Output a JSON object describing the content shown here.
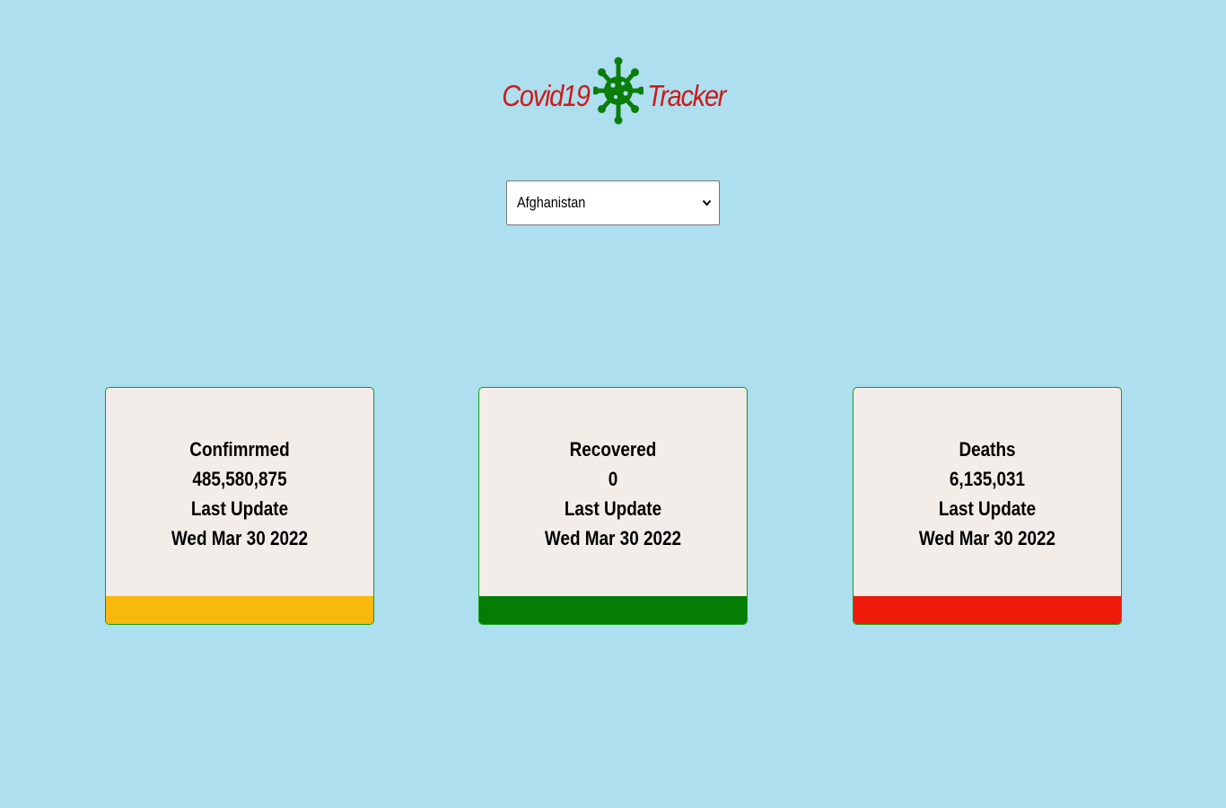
{
  "header": {
    "title_left": "Covid19",
    "title_right": "Tracker",
    "title_color": "#cc1a1a",
    "logo_icon": "virus-icon",
    "logo_color": "#0a7d0a"
  },
  "country_select": {
    "selected": "Afghanistan",
    "icon": "chevron-down-icon"
  },
  "cards": [
    {
      "label": "Confimrmed",
      "value": "485,580,875",
      "update_label": "Last Update",
      "update_date": "Wed Mar 30 2022",
      "bar_color": "#f8b80c"
    },
    {
      "label": "Recovered",
      "value": "0",
      "update_label": "Last Update",
      "update_date": "Wed Mar 30 2022",
      "bar_color": "#047d04"
    },
    {
      "label": "Deaths",
      "value": "6,135,031",
      "update_label": "Last Update",
      "update_date": "Wed Mar 30 2022",
      "bar_color": "#ee1a0a"
    }
  ],
  "colors": {
    "background": "#addfee",
    "card_background": "#f2ede9",
    "card_border": "#12a012"
  }
}
